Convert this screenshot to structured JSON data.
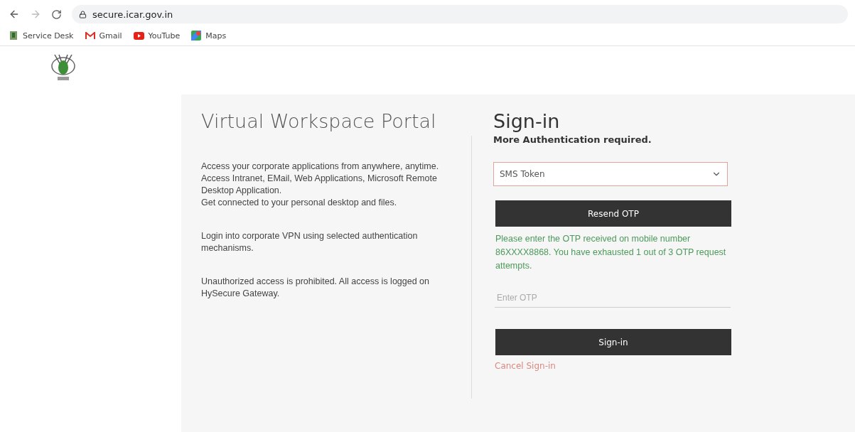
{
  "browser": {
    "url": "secure.icar.gov.in",
    "bookmarks": [
      {
        "label": "Service Desk",
        "kind": "emblem"
      },
      {
        "label": "Gmail",
        "kind": "mail"
      },
      {
        "label": "YouTube",
        "kind": "video"
      },
      {
        "label": "Maps",
        "kind": "map"
      }
    ]
  },
  "portal": {
    "title": "Virtual Workspace Portal",
    "paragraphs": [
      [
        "Access your corporate applications from anywhere, anytime.",
        "Access Intranet, EMail, Web Applications, Microsoft Remote Desktop Application.",
        "Get connected to your personal desktop and files."
      ],
      [
        "Login into corporate VPN using selected authentication mechanisms."
      ],
      [
        "Unauthorized access is prohibited. All access is logged on HySecure Gateway."
      ]
    ]
  },
  "signin": {
    "title": "Sign-in",
    "subtitle": "More Authentication required.",
    "method": "SMS Token",
    "resend_button": "Resend OTP",
    "message": "Please enter the OTP received on mobile number 86XXXX8868. You have exhausted 1 out of 3 OTP request attempts.",
    "otp": {
      "placeholder": "Enter OTP"
    },
    "submit_button": "Sign-in",
    "cancel_link": "Cancel Sign-in"
  }
}
